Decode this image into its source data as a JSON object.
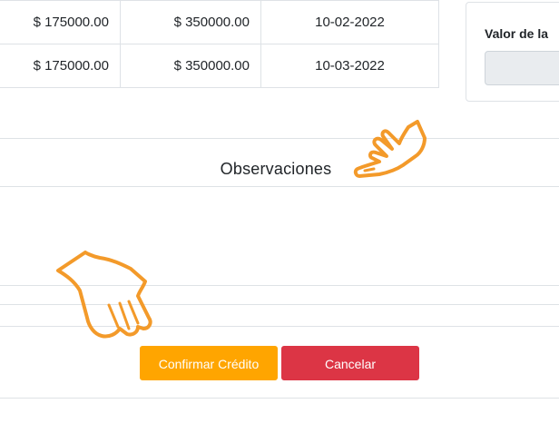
{
  "table": {
    "rows": [
      {
        "col1": "$ 175000.00",
        "col2": "$ 350000.00",
        "col3": "10-02-2022"
      },
      {
        "col1": "$ 175000.00",
        "col2": "$ 350000.00",
        "col3": "10-03-2022"
      }
    ]
  },
  "side_panel": {
    "label": "Valor de la",
    "input_value": ""
  },
  "observations": {
    "title": "Observaciones"
  },
  "actions": {
    "confirm_label": "Confirmar Crédito",
    "cancel_label": "Cancelar"
  },
  "colors": {
    "confirm": "#ffa500",
    "cancel": "#dc3545",
    "annotation": "#f39a2a"
  },
  "icons": {
    "annotation_top": "pointing-hand-icon",
    "annotation_bottom": "pointing-hand-icon"
  }
}
